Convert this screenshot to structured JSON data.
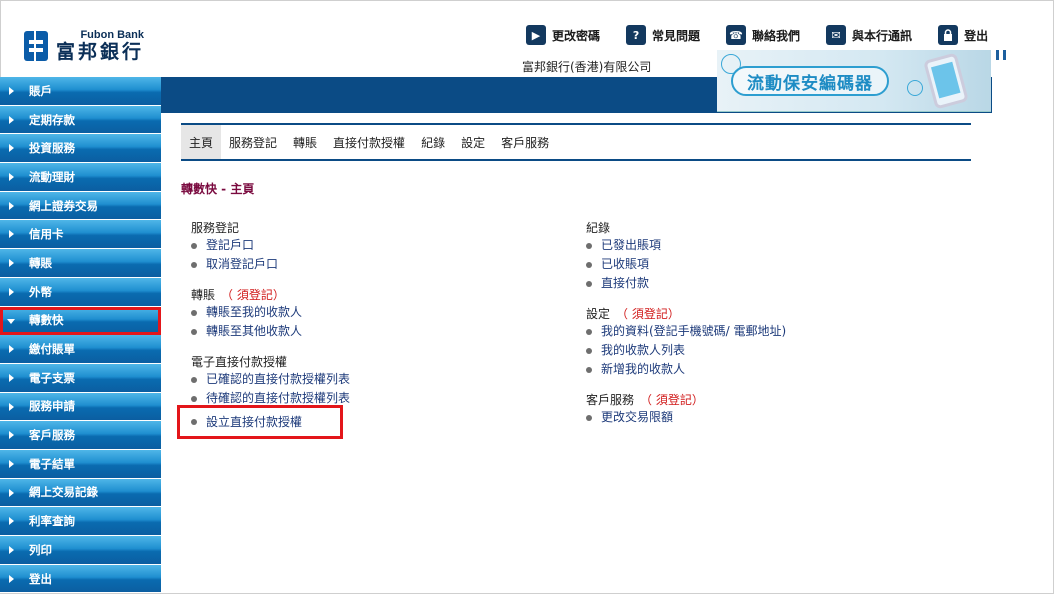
{
  "header": {
    "logo_en": "Fubon Bank",
    "logo_zh": "富邦銀行",
    "company": "富邦銀行(香港)有限公司",
    "links": [
      {
        "label": "更改密碼",
        "icon": "play-arrow-icon"
      },
      {
        "label": "常見問題",
        "icon": "question-icon"
      },
      {
        "label": "聯絡我們",
        "icon": "phone-icon"
      },
      {
        "label": "與本行通訊",
        "icon": "mail-icon"
      },
      {
        "label": "登出",
        "icon": "lock-icon"
      }
    ]
  },
  "banner": {
    "text": "流動保安編碼器"
  },
  "sidebar": {
    "items": [
      {
        "label": "賬戶"
      },
      {
        "label": "定期存款"
      },
      {
        "label": "投資服務"
      },
      {
        "label": "流動理財"
      },
      {
        "label": "網上證券交易"
      },
      {
        "label": "信用卡"
      },
      {
        "label": "轉賬"
      },
      {
        "label": "外幣"
      },
      {
        "label": "轉數快",
        "active": true
      },
      {
        "label": "繳付賬單"
      },
      {
        "label": "電子支票"
      },
      {
        "label": "服務申請"
      },
      {
        "label": "客戶服務"
      },
      {
        "label": "電子結單"
      },
      {
        "label": "網上交易記錄"
      },
      {
        "label": "利率查詢"
      },
      {
        "label": "列印"
      },
      {
        "label": "登出"
      }
    ]
  },
  "tabs": [
    {
      "label": "主頁",
      "active": true
    },
    {
      "label": "服務登記"
    },
    {
      "label": "轉賬"
    },
    {
      "label": "直接付款授權"
    },
    {
      "label": "紀錄"
    },
    {
      "label": "設定"
    },
    {
      "label": "客戶服務"
    }
  ],
  "breadcrumb": "轉數快 - 主頁",
  "left_groups": [
    {
      "title": "服務登記",
      "req": "",
      "items": [
        "登記戶口",
        "取消登記戶口"
      ]
    },
    {
      "title": "轉賬",
      "req": "（ 須登記）",
      "items": [
        "轉賬至我的收款人",
        "轉賬至其他收款人"
      ]
    },
    {
      "title": "電子直接付款授權",
      "req": "",
      "items": [
        "已確認的直接付款授權列表",
        "待確認的直接付款授權列表",
        "設立直接付款授權"
      ]
    }
  ],
  "right_groups": [
    {
      "title": "紀錄",
      "req": "",
      "items": [
        "已發出賬項",
        "已收賬項",
        "直接付款"
      ]
    },
    {
      "title": "設定",
      "req": "（ 須登記）",
      "items": [
        "我的資料(登記手機號碼/ 電郵地址)",
        "我的收款人列表",
        "新增我的收款人"
      ]
    },
    {
      "title": "客戶服務",
      "req": "（ 須登記）",
      "items": [
        "更改交易限額"
      ]
    }
  ]
}
